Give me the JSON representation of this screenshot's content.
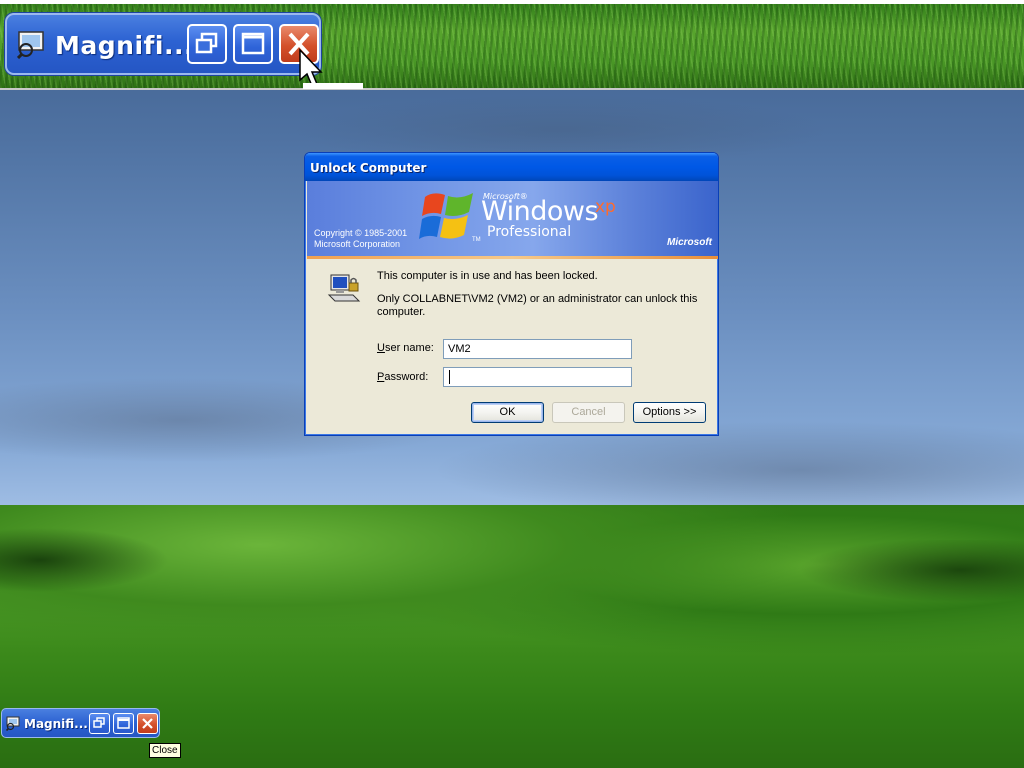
{
  "magnifier_view": {
    "toolbar_title": "Magnifi...",
    "icons": [
      "magnifier-app-icon",
      "restore-icon",
      "maximize-icon",
      "close-icon",
      "mouse-pointer-icon"
    ]
  },
  "dialog": {
    "title": "Unlock Computer",
    "banner": {
      "microsoft_small": "Microsoft®",
      "product": "Windows",
      "product_suffix": "xp",
      "edition": "Professional",
      "trademark": "TM",
      "copyright_line1": "Copyright © 1985-2001",
      "copyright_line2": "Microsoft Corporation",
      "brand": "Microsoft"
    },
    "message_locked": "This computer is in use and has been locked.",
    "message_unlock": "Only COLLABNET\\VM2 (VM2) or an administrator can unlock this computer.",
    "username_label_accel": "U",
    "username_label_rest": "ser name:",
    "username_value": "VM2",
    "password_label_accel": "P",
    "password_label_rest": "assword:",
    "password_value": "",
    "buttons": {
      "ok": "OK",
      "cancel": "Cancel",
      "options": "Options >>"
    }
  },
  "taskbar_magnifier": {
    "title": "Magnifi...",
    "tooltip": "Close"
  },
  "colors": {
    "titlebar_blue": "#0058e6",
    "dialog_face": "#ece9d8",
    "close_red": "#d4502b",
    "xp_orange": "#ff6b2c"
  }
}
